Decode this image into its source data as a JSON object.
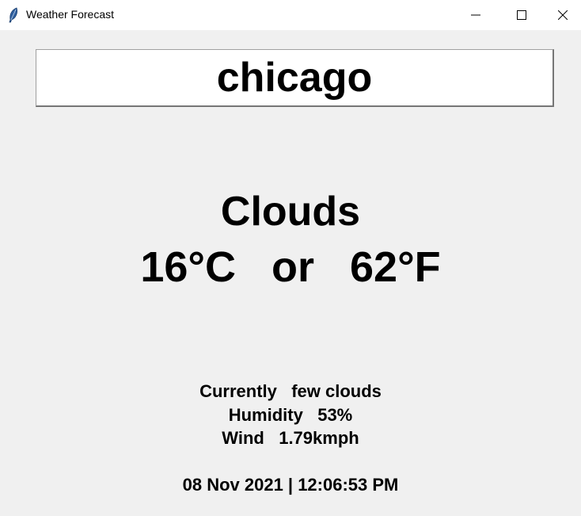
{
  "window": {
    "title": "Weather Forecast",
    "icon": "feather-icon"
  },
  "search": {
    "city_value": "chicago"
  },
  "weather": {
    "condition": "Clouds",
    "temp_c": "16°C",
    "separator": "or",
    "temp_f": "62°F",
    "currently_label": "Currently",
    "currently_value": "few clouds",
    "humidity_label": "Humidity",
    "humidity_value": "53%",
    "wind_label": "Wind",
    "wind_value": "1.79kmph",
    "datetime": "08 Nov 2021 | 12:06:53 PM"
  },
  "colors": {
    "background": "#f0f0f0",
    "titlebar": "#ffffff",
    "text": "#000000"
  }
}
